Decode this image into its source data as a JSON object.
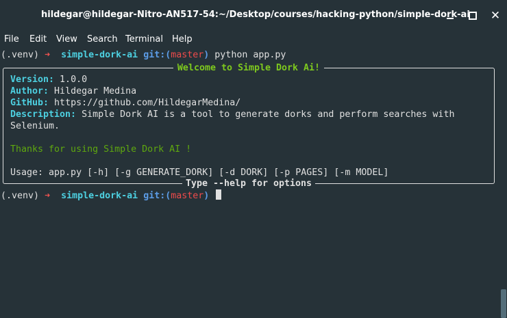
{
  "window": {
    "title": "hildegar@hildegar-Nitro-AN517-54:~/Desktop/courses/hacking-python/simple-dork-ai",
    "close_glyph": "✕"
  },
  "menu": [
    "File",
    "Edit",
    "View",
    "Search",
    "Terminal",
    "Help"
  ],
  "prompt": {
    "venv": "(.venv)",
    "arrow": "➜",
    "dir": "simple-dork-ai",
    "git_label": "git:(",
    "branch": "master",
    "git_close": ")"
  },
  "command": "python app.py",
  "panel": {
    "title": "Welcome to Simple Dork Ai!",
    "subtitle": "Type --help for options",
    "version_key": "Version:",
    "version_val": " 1.0.0",
    "author_key": "Author:",
    "author_val": " Hildegar Medina",
    "github_key": "GitHub:",
    "github_val": " https://github.com/HildegarMedina/",
    "description_key": "Description:",
    "description_val": " Simple Dork AI is a tool to generate dorks and perform searches with",
    "description_val2": "Selenium.",
    "thanks": "Thanks for using Simple Dork AI !",
    "usage": "Usage: app.py [-h] [-g GENERATE_DORK] [-d DORK] [-p PAGES] [-m MODEL]"
  },
  "colors": {
    "background": "#263238",
    "prompt_dir": "#4dd0e1",
    "git": "#5c9de8",
    "branch": "#ef4b4b",
    "panel_title": "#7ec91e",
    "thanks": "#5fa80f"
  }
}
